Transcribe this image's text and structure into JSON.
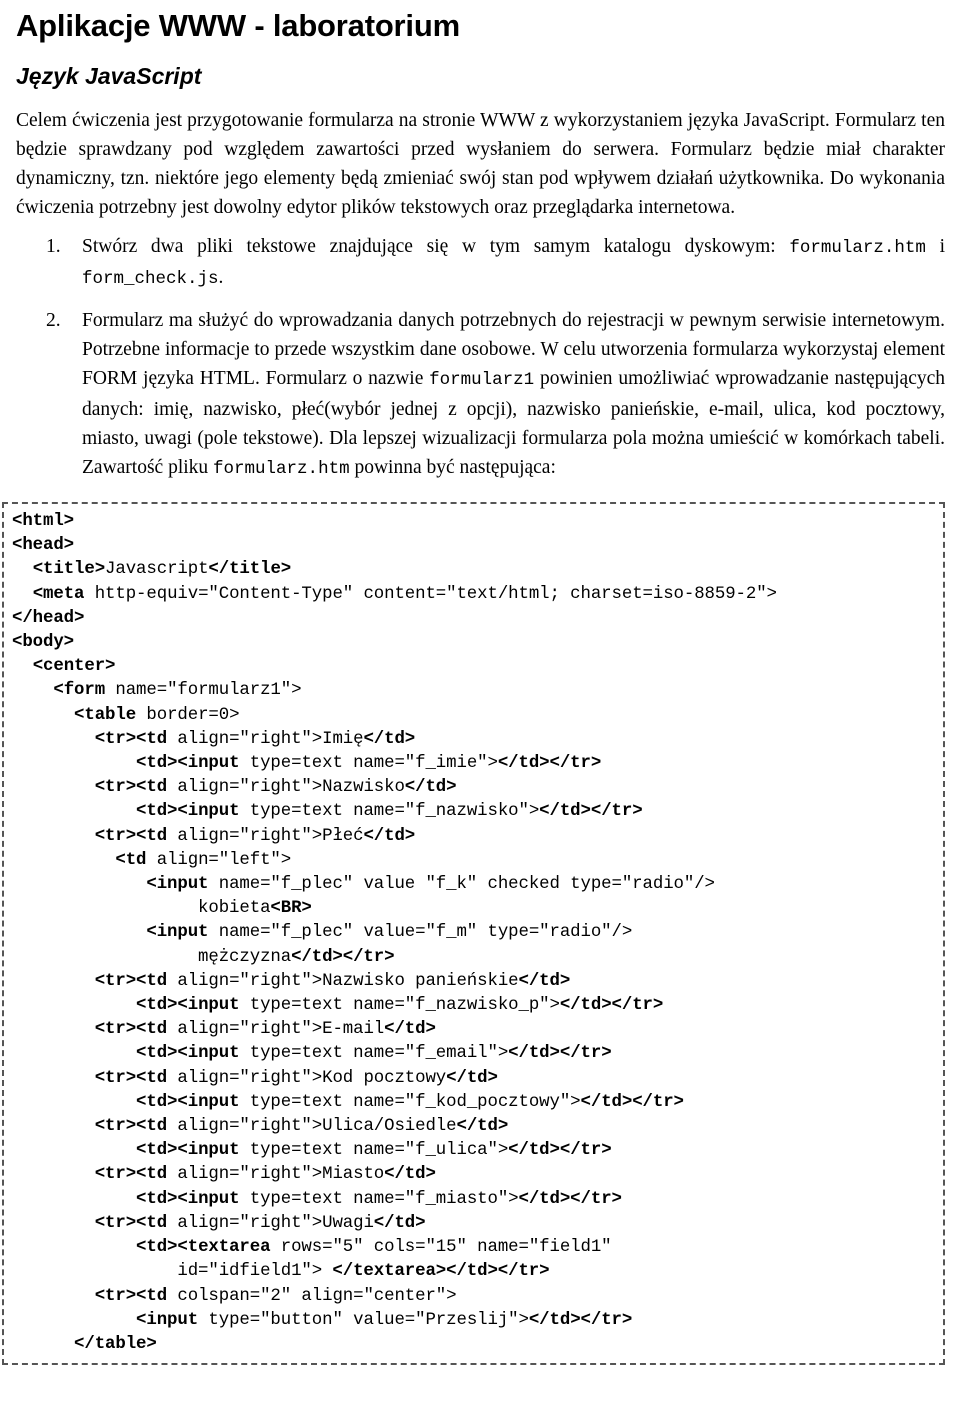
{
  "document": {
    "title": "Aplikacje WWW - laboratorium",
    "subtitle": "Język JavaScript",
    "intro": "Celem ćwiczenia jest przygotowanie formularza na stronie WWW z wykorzystaniem języka JavaScript. Formularz ten będzie sprawdzany pod względem zawartości przed wysłaniem do serwera. Formularz będzie miał charakter dynamiczny, tzn. niektóre jego elementy będą zmieniać swój stan pod wpływem działań użytkownika. Do wykonania ćwiczenia potrzebny jest dowolny edytor plików tekstowych oraz przeglądarka internetowa."
  },
  "tasks": [
    {
      "number": "1.",
      "parts": [
        {
          "type": "text",
          "value": "Stwórz dwa pliki tekstowe znajdujące się w tym samym katalogu dyskowym: "
        },
        {
          "type": "mono",
          "value": "formularz.htm"
        },
        {
          "type": "text",
          "value": " i "
        },
        {
          "type": "mono",
          "value": "form_check.js"
        },
        {
          "type": "text",
          "value": "."
        }
      ]
    },
    {
      "number": "2.",
      "parts": [
        {
          "type": "text",
          "value": "Formularz ma służyć do wprowadzania danych potrzebnych do rejestracji w pewnym serwisie internetowym. Potrzebne informacje to przede wszystkim dane osobowe. W celu utworzenia formularza wykorzystaj element FORM języka HTML. Formularz o nazwie "
        },
        {
          "type": "mono",
          "value": "formularz1"
        },
        {
          "type": "text",
          "value": " powinien umożliwiać wprowadzanie następujących danych: imię, nazwisko, płeć(wybór jednej z opcji), nazwisko panieńskie, e-mail, ulica, kod pocztowy, miasto, uwagi (pole tekstowe). Dla lepszej wizualizacji formularza pola można umieścić w komórkach tabeli. Zawartość pliku "
        },
        {
          "type": "mono",
          "value": "formularz.htm"
        },
        {
          "type": "text",
          "value": " powinna być następująca:"
        }
      ]
    }
  ],
  "code_listing": {
    "language": "html",
    "lines": [
      [
        {
          "b": "<html>"
        }
      ],
      [
        {
          "b": "<head>"
        }
      ],
      [
        {
          "t": "  "
        },
        {
          "b": "<title>"
        },
        {
          "t": "Javascript"
        },
        {
          "b": "</title>"
        }
      ],
      [
        {
          "t": "  "
        },
        {
          "b": "<meta"
        },
        {
          "t": " http-equiv=\"Content-Type\" content=\"text/html; charset=iso-8859-2\">"
        }
      ],
      [
        {
          "b": "</head>"
        }
      ],
      [
        {
          "b": "<body>"
        }
      ],
      [
        {
          "t": "  "
        },
        {
          "b": "<center>"
        }
      ],
      [
        {
          "t": "    "
        },
        {
          "b": "<form"
        },
        {
          "t": " name=\"formularz1\">"
        }
      ],
      [
        {
          "t": "      "
        },
        {
          "b": "<table"
        },
        {
          "t": " border=0>"
        }
      ],
      [
        {
          "t": "        "
        },
        {
          "b": "<tr><td"
        },
        {
          "t": " align=\"right\">Imię"
        },
        {
          "b": "</td>"
        }
      ],
      [
        {
          "t": "            "
        },
        {
          "b": "<td><input"
        },
        {
          "t": " type=text name=\"f_imie\">"
        },
        {
          "b": "</td></tr>"
        }
      ],
      [
        {
          "t": "        "
        },
        {
          "b": "<tr><td"
        },
        {
          "t": " align=\"right\">Nazwisko"
        },
        {
          "b": "</td>"
        }
      ],
      [
        {
          "t": "            "
        },
        {
          "b": "<td><input"
        },
        {
          "t": " type=text name=\"f_nazwisko\">"
        },
        {
          "b": "</td></tr>"
        }
      ],
      [
        {
          "t": "        "
        },
        {
          "b": "<tr><td"
        },
        {
          "t": " align=\"right\">Płeć"
        },
        {
          "b": "</td>"
        }
      ],
      [
        {
          "t": "          "
        },
        {
          "b": "<td"
        },
        {
          "t": " align=\"left\">"
        }
      ],
      [
        {
          "t": "             "
        },
        {
          "b": "<input"
        },
        {
          "t": " name=\"f_plec\" value \"f_k\" checked type=\"radio\"/>"
        }
      ],
      [
        {
          "t": "                  kobieta"
        },
        {
          "b": "<BR>"
        }
      ],
      [
        {
          "t": "             "
        },
        {
          "b": "<input"
        },
        {
          "t": " name=\"f_plec\" value=\"f_m\" type=\"radio\"/>"
        }
      ],
      [
        {
          "t": "                  mężczyzna"
        },
        {
          "b": "</td></tr>"
        }
      ],
      [
        {
          "t": "        "
        },
        {
          "b": "<tr><td"
        },
        {
          "t": " align=\"right\">Nazwisko panieńskie"
        },
        {
          "b": "</td>"
        }
      ],
      [
        {
          "t": "            "
        },
        {
          "b": "<td><input"
        },
        {
          "t": " type=text name=\"f_nazwisko_p\">"
        },
        {
          "b": "</td></tr>"
        }
      ],
      [
        {
          "t": "        "
        },
        {
          "b": "<tr><td"
        },
        {
          "t": " align=\"right\">E-mail"
        },
        {
          "b": "</td>"
        }
      ],
      [
        {
          "t": "            "
        },
        {
          "b": "<td><input"
        },
        {
          "t": " type=text name=\"f_email\">"
        },
        {
          "b": "</td></tr>"
        }
      ],
      [
        {
          "t": "        "
        },
        {
          "b": "<tr><td"
        },
        {
          "t": " align=\"right\">Kod pocztowy"
        },
        {
          "b": "</td>"
        }
      ],
      [
        {
          "t": "            "
        },
        {
          "b": "<td><input"
        },
        {
          "t": " type=text name=\"f_kod_pocztowy\">"
        },
        {
          "b": "</td></tr>"
        }
      ],
      [
        {
          "t": "        "
        },
        {
          "b": "<tr><td"
        },
        {
          "t": " align=\"right\">Ulica/Osiedle"
        },
        {
          "b": "</td>"
        }
      ],
      [
        {
          "t": "            "
        },
        {
          "b": "<td><input"
        },
        {
          "t": " type=text name=\"f_ulica\">"
        },
        {
          "b": "</td></tr>"
        }
      ],
      [
        {
          "t": "        "
        },
        {
          "b": "<tr><td"
        },
        {
          "t": " align=\"right\">Miasto"
        },
        {
          "b": "</td>"
        }
      ],
      [
        {
          "t": "            "
        },
        {
          "b": "<td><input"
        },
        {
          "t": " type=text name=\"f_miasto\">"
        },
        {
          "b": "</td></tr>"
        }
      ],
      [
        {
          "t": "        "
        },
        {
          "b": "<tr><td"
        },
        {
          "t": " align=\"right\">Uwagi"
        },
        {
          "b": "</td>"
        }
      ],
      [
        {
          "t": "            "
        },
        {
          "b": "<td><textarea"
        },
        {
          "t": " rows=\"5\" cols=\"15\" name=\"field1\""
        }
      ],
      [
        {
          "t": "                id=\"idfield1\"> "
        },
        {
          "b": "</textarea></td></tr>"
        }
      ],
      [
        {
          "t": "        "
        },
        {
          "b": "<tr><td"
        },
        {
          "t": " colspan=\"2\" align=\"center\">"
        }
      ],
      [
        {
          "t": "            "
        },
        {
          "b": "<input"
        },
        {
          "t": " type=\"button\" value=\"Przeslij\">"
        },
        {
          "b": "</td></tr>"
        }
      ],
      [
        {
          "t": "      "
        },
        {
          "b": "</table>"
        }
      ]
    ]
  }
}
